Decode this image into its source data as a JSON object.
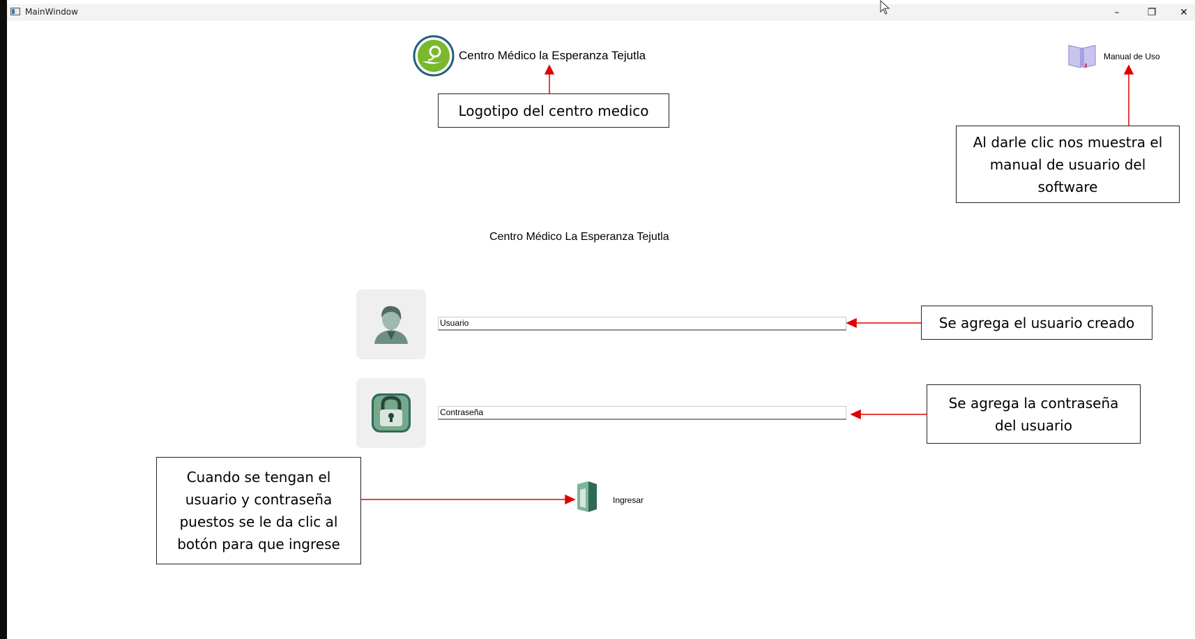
{
  "window": {
    "title": "MainWindow",
    "controls": {
      "minimize": "–",
      "maximize": "❐",
      "close": "✕"
    }
  },
  "header": {
    "logo_label": "Centro Médico la Esperanza Tejutla",
    "manual_button_label": "Manual de Uso"
  },
  "main": {
    "title": "Centro Médico La Esperanza Tejutla",
    "user_field": "Usuario",
    "password_field": "Contraseña",
    "login_button_label": "Ingresar"
  },
  "annotations": {
    "logo": "Logotipo del centro medico",
    "manual": "Al darle clic nos muestra el manual de usuario del software",
    "user": "Se agrega el usuario creado",
    "password": "Se agrega la contraseña del usuario",
    "login": "Cuando se tengan el usuario y contraseña puestos se le da clic al botón para que ingrese"
  },
  "colors": {
    "arrow": "#e00000",
    "logo_ring": "#1f5f7a",
    "logo_green": "#7ab82e",
    "tile_bg": "#efefef"
  }
}
